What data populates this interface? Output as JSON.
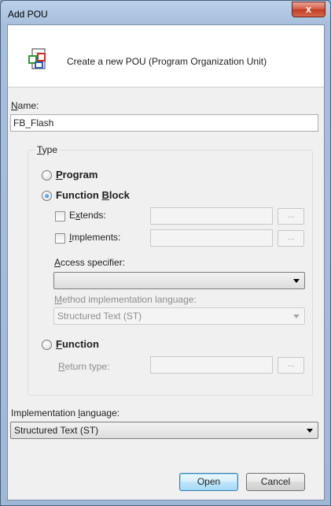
{
  "window": {
    "title": "Add POU",
    "close_label": "x"
  },
  "header": {
    "text": "Create a new POU (Program Organization Unit)",
    "icon": "pou-icon"
  },
  "name": {
    "label_u": "N",
    "label_rest": "ame:",
    "value": "FB_Flash"
  },
  "type_group": {
    "legend_u": "T",
    "legend_rest": "ype",
    "program": {
      "label_u": "P",
      "label_rest": "rogram",
      "checked": false
    },
    "function_block": {
      "label_pre": "Function ",
      "label_u": "B",
      "label_rest": "lock",
      "checked": true,
      "extends": {
        "label_pre": "E",
        "label_u": "x",
        "label_rest": "tends:",
        "value": "",
        "browse": "..."
      },
      "implements": {
        "label_u": "I",
        "label_rest": "mplements:",
        "value": "",
        "browse": "..."
      },
      "access_specifier": {
        "label_u": "A",
        "label_rest": "ccess specifier:",
        "value": ""
      },
      "method_language": {
        "label_u": "M",
        "label_rest": "ethod implementation language:",
        "value": "Structured Text (ST)"
      }
    },
    "function": {
      "label_u": "F",
      "label_rest": "unction",
      "checked": false,
      "return_type": {
        "label_u": "R",
        "label_rest": "eturn type:",
        "value": "",
        "browse": "..."
      }
    }
  },
  "impl_language": {
    "label_pre": "Implementation ",
    "label_u": "l",
    "label_rest": "anguage:",
    "value": "Structured Text (ST)"
  },
  "buttons": {
    "open": "Open",
    "cancel": "Cancel"
  }
}
